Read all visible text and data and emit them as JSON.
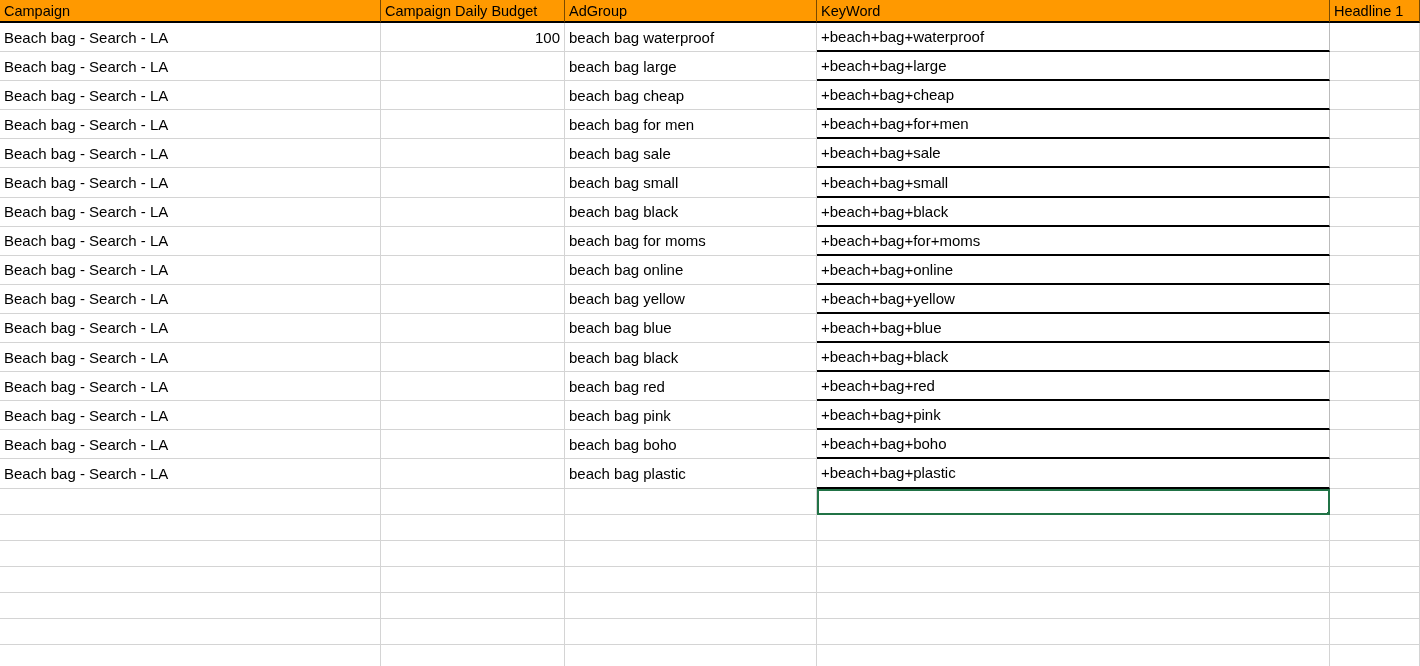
{
  "table": {
    "columns": [
      "Campaign",
      "Campaign Daily Budget",
      "AdGroup",
      "KeyWord",
      "Headline 1"
    ],
    "rows": [
      {
        "campaign": "Beach bag - Search - LA",
        "budget": "100",
        "adgroup": "beach bag waterproof",
        "keyword": "+beach+bag+waterproof"
      },
      {
        "campaign": "Beach bag - Search - LA",
        "adgroup": "beach bag large",
        "keyword": "+beach+bag+large"
      },
      {
        "campaign": "Beach bag - Search - LA",
        "adgroup": "beach bag cheap",
        "keyword": "+beach+bag+cheap"
      },
      {
        "campaign": "Beach bag - Search - LA",
        "adgroup": "beach bag for men",
        "keyword": "+beach+bag+for+men"
      },
      {
        "campaign": "Beach bag - Search - LA",
        "adgroup": "beach bag sale",
        "keyword": "+beach+bag+sale"
      },
      {
        "campaign": "Beach bag - Search - LA",
        "adgroup": "beach bag small",
        "keyword": "+beach+bag+small"
      },
      {
        "campaign": "Beach bag - Search - LA",
        "adgroup": "beach bag black",
        "keyword": "+beach+bag+black"
      },
      {
        "campaign": "Beach bag - Search - LA",
        "adgroup": "beach bag for moms",
        "keyword": "+beach+bag+for+moms"
      },
      {
        "campaign": "Beach bag - Search - LA",
        "adgroup": "beach bag online",
        "keyword": "+beach+bag+online"
      },
      {
        "campaign": "Beach bag - Search - LA",
        "adgroup": "beach bag yellow",
        "keyword": "+beach+bag+yellow"
      },
      {
        "campaign": "Beach bag - Search - LA",
        "adgroup": "beach bag blue",
        "keyword": "+beach+bag+blue"
      },
      {
        "campaign": "Beach bag - Search - LA",
        "adgroup": "beach bag black",
        "keyword": "+beach+bag+black"
      },
      {
        "campaign": "Beach bag - Search - LA",
        "adgroup": "beach bag red",
        "keyword": "+beach+bag+red"
      },
      {
        "campaign": "Beach bag - Search - LA",
        "adgroup": "beach bag pink",
        "keyword": "+beach+bag+pink"
      },
      {
        "campaign": "Beach bag - Search - LA",
        "adgroup": "beach bag boho",
        "keyword": "+beach+bag+boho"
      },
      {
        "campaign": "Beach bag - Search - LA",
        "adgroup": "beach bag plastic",
        "keyword": "+beach+bag+plastic"
      }
    ],
    "blank_rows": [
      {
        "selected": true
      },
      {
        "selected": false
      },
      {
        "selected": false
      },
      {
        "selected": false
      },
      {
        "selected": false
      },
      {
        "selected": false
      },
      {
        "selected": false
      }
    ]
  }
}
